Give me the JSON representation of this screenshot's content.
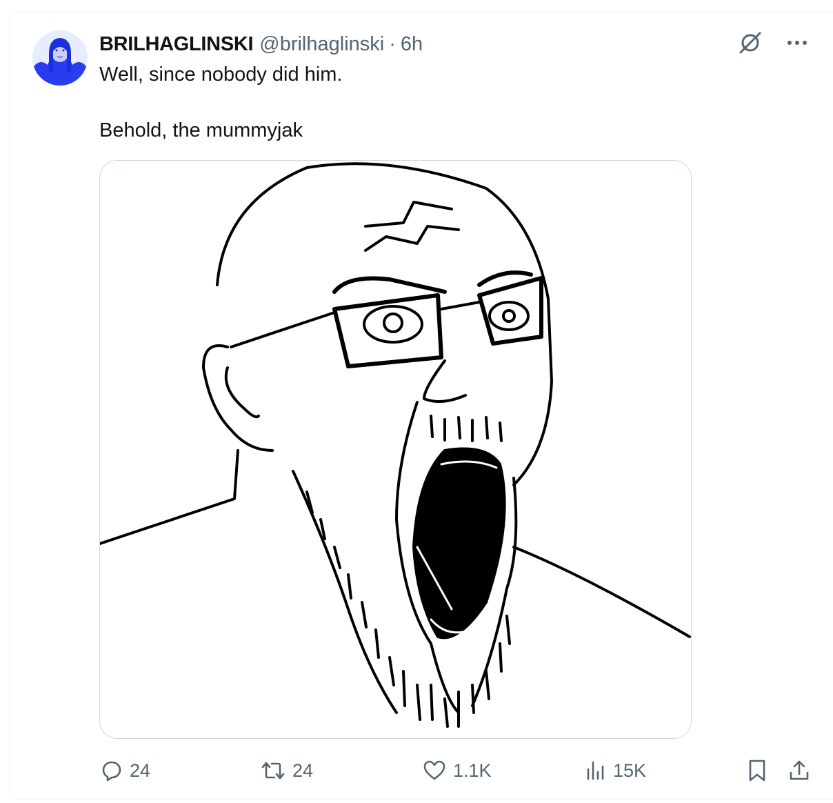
{
  "tweet": {
    "display_name": "BRILHAGLINSKI",
    "handle": "@brilhaglinski",
    "separator": "·",
    "time": "6h",
    "text_line1": "Well, since nobody did him.",
    "text_line2": "Behold, the mummyjak"
  },
  "actions": {
    "replies": "24",
    "reposts": "24",
    "likes": "1.1K",
    "views": "15K"
  },
  "icons": [
    "grok-icon",
    "more-icon",
    "reply-icon",
    "repost-icon",
    "like-icon",
    "views-icon",
    "bookmark-icon",
    "share-icon"
  ],
  "colors": {
    "secondary_text": "#536471",
    "border": "#cfd9de",
    "text": "#0f1419",
    "avatar_blue": "#1d3cff"
  }
}
